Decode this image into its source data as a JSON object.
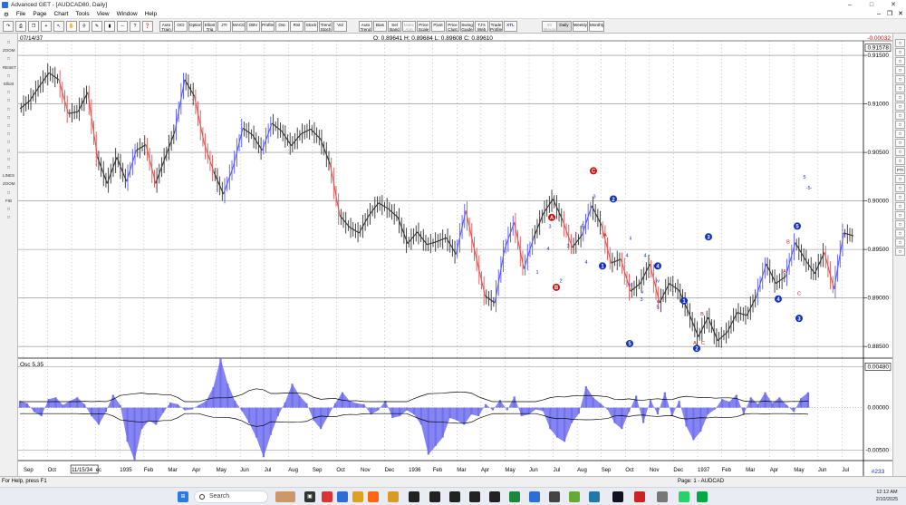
{
  "window": {
    "title": "Advanced GET - [AUDCAD80, Daily]"
  },
  "menu": [
    "File",
    "Page",
    "Chart",
    "Tools",
    "View",
    "Window",
    "Help"
  ],
  "toolbar": [
    {
      "label": "Auto Train",
      "state": "normal"
    },
    {
      "label": "OCI",
      "state": "normal"
    },
    {
      "label": "Option",
      "state": "normal"
    },
    {
      "label": "Elliott Trig",
      "state": "normal"
    },
    {
      "label": "JTI",
      "state": "normal"
    },
    {
      "label": "MACD",
      "state": "normal"
    },
    {
      "label": "OBV",
      "state": "normal"
    },
    {
      "label": "Profile",
      "state": "normal"
    },
    {
      "label": "Osc",
      "state": "normal"
    },
    {
      "label": "RSI",
      "state": "normal"
    },
    {
      "label": "Stock",
      "state": "normal"
    },
    {
      "label": "Trend Stoch",
      "state": "normal"
    },
    {
      "label": "Vol",
      "state": "normal"
    },
    {
      "label": "Auto Trend",
      "state": "normal"
    },
    {
      "label": "Bias",
      "state": "normal"
    },
    {
      "label": "Sel Band",
      "state": "normal"
    },
    {
      "label": "Make Ann",
      "state": "disabled"
    },
    {
      "label": "Price Scale",
      "state": "normal"
    },
    {
      "label": "Pivot",
      "state": "normal"
    },
    {
      "label": "Price Clust",
      "state": "normal"
    },
    {
      "label": "Swing Guide",
      "state": "normal"
    },
    {
      "label": "TJ's Web",
      "state": "normal"
    },
    {
      "label": "Trade Profile",
      "state": "normal"
    },
    {
      "label": "XTL",
      "state": "blue"
    },
    {
      "label": "60 Minute",
      "state": "disabled"
    },
    {
      "label": "Daily",
      "state": "active"
    },
    {
      "label": "Weekly",
      "state": "normal"
    },
    {
      "label": "Monthly",
      "state": "normal"
    }
  ],
  "left_tools": [
    "",
    "ZOOM",
    "",
    "RESET",
    "",
    "Elliott",
    "",
    "",
    "",
    "",
    "",
    "",
    "",
    "",
    "",
    "",
    "LINES",
    "ZOOM",
    "",
    "FIB",
    "",
    ""
  ],
  "right_tools": [
    "",
    "",
    "",
    "",
    "",
    "",
    "",
    "",
    "",
    "",
    "",
    "",
    "",
    "",
    "PTI",
    "",
    "",
    "",
    "",
    "",
    "",
    "",
    "",
    ""
  ],
  "chart_header": {
    "date": "07/14/37",
    "ohlc": "O: 0.89641   H: 0.89684   L: 0.89608   C: 0.89610",
    "last_change": "-0.00032"
  },
  "oscillator_label": "Osc 5,35",
  "bar_count": "#233",
  "status": {
    "left": "For Help, press F1",
    "right": "Page: 1 - AUDCAD"
  },
  "taskbar": {
    "search": "Search",
    "time": "12:12 AM",
    "date": "2/10/2025"
  },
  "colors": {
    "bull_wave": "#5a5aff",
    "bear_wave": "#e05555",
    "neutral": "#333333",
    "osc_fill": "#7070f0",
    "wave_label_blue": "#1030c0",
    "wave_label_red": "#d01010"
  },
  "chart_data": [
    {
      "type": "line",
      "title": "",
      "xlabel": "",
      "ylabel": "",
      "ylim": [
        0.8838,
        0.9165
      ],
      "y_ticks": [
        0.915,
        0.91,
        0.905,
        0.9,
        0.895,
        0.89,
        0.885
      ],
      "y_marker": 0.91578,
      "x_ticks": [
        "Sep",
        "Oct",
        "11/15/34",
        "ec",
        "1935",
        "Feb",
        "Mar",
        "Apr",
        "May",
        "Jun",
        "Jul",
        "Aug",
        "Sep",
        "Oct",
        "Nov",
        "Dec",
        "1936",
        "Feb",
        "Mar",
        "Apr",
        "May",
        "Jun",
        "Jul",
        "Aug",
        "Sep",
        "Oct",
        "Nov",
        "Dec",
        "1937",
        "Feb",
        "Mar",
        "Apr",
        "May",
        "Jun",
        "Jul"
      ],
      "series": [
        {
          "values": [
            0.9095,
            0.9103,
            0.9118,
            0.9132,
            0.9125,
            0.909,
            0.9092,
            0.9112,
            0.9045,
            0.9018,
            0.9045,
            0.902,
            0.9052,
            0.9058,
            0.9018,
            0.9045,
            0.9072,
            0.9125,
            0.9108,
            0.906,
            0.903,
            0.9007,
            0.9035,
            0.9075,
            0.9068,
            0.9052,
            0.908,
            0.9072,
            0.9057,
            0.9069,
            0.9074,
            0.9064,
            0.9038,
            0.8985,
            0.8973,
            0.8967,
            0.8985,
            0.8998,
            0.8992,
            0.8983,
            0.8956,
            0.8968,
            0.8955,
            0.8958,
            0.8962,
            0.8945,
            0.899,
            0.8945,
            0.8902,
            0.8895,
            0.895,
            0.8978,
            0.893,
            0.8962,
            0.8987,
            0.9002,
            0.898,
            0.8952,
            0.8965,
            0.8995,
            0.8975,
            0.8936,
            0.894,
            0.8907,
            0.8915,
            0.8935,
            0.8895,
            0.8915,
            0.8908,
            0.8885,
            0.886,
            0.888,
            0.8856,
            0.8865,
            0.8885,
            0.8882,
            0.8902,
            0.8935,
            0.8915,
            0.8922,
            0.8957,
            0.894,
            0.8925,
            0.8947,
            0.8909,
            0.8967,
            0.8964
          ]
        }
      ],
      "wave_labels": [
        {
          "text": "A",
          "style": "red-circle",
          "x": 0.898,
          "y": 0.8983
        },
        {
          "text": "B",
          "style": "red-circle",
          "x": 0.8911,
          "y": 0.8911
        },
        {
          "text": "C",
          "style": "red-circle",
          "x": 0.9031,
          "y": 0.9031
        },
        {
          "text": "1",
          "style": "blue-circle",
          "x": 0.8933,
          "y": 0.8933
        },
        {
          "text": "2",
          "style": "blue-circle",
          "x": 0.9002,
          "y": 0.9002
        },
        {
          "text": "3",
          "style": "blue-circle",
          "x": 0.8879,
          "y": 0.8879
        },
        {
          "text": "4",
          "style": "blue-circle",
          "x": 0.8933,
          "y": 0.8933
        },
        {
          "text": "5",
          "style": "blue-circle",
          "x": 0.8853,
          "y": 0.8853
        },
        {
          "text": "1",
          "style": "blue-circle",
          "x": 0.8897,
          "y": 0.8897
        },
        {
          "text": "2",
          "style": "blue-circle",
          "x": 0.8848,
          "y": 0.8848
        },
        {
          "text": "3",
          "style": "blue-circle",
          "x": 0.8963,
          "y": 0.8963
        },
        {
          "text": "4",
          "style": "blue-circle",
          "x": 0.8899,
          "y": 0.8899
        },
        {
          "text": "5",
          "style": "blue-circle",
          "x": 0.8974,
          "y": 0.8974
        },
        {
          "text": "5",
          "style": "blue-text",
          "x": 0.9023,
          "y": 0.9023
        },
        {
          "text": "3",
          "style": "blue-text",
          "x": 0.9003,
          "y": 0.9003
        },
        {
          "text": "4",
          "style": "blue-text",
          "x": 0.8949,
          "y": 0.8949
        },
        {
          "text": "3",
          "style": "blue-text",
          "x": 0.8972,
          "y": 0.8972
        },
        {
          "text": "5",
          "style": "blue-text",
          "x": 0.8972,
          "y": 0.8972
        },
        {
          "text": "4",
          "style": "blue-text",
          "x": 0.8935,
          "y": 0.8935
        },
        {
          "text": "2",
          "style": "blue-text",
          "x": 0.8916,
          "y": 0.8916
        },
        {
          "text": "1",
          "style": "blue-text",
          "x": 0.8925,
          "y": 0.8925
        },
        {
          "text": "3",
          "style": "blue-text",
          "x": 0.8952,
          "y": 0.8952
        },
        {
          "text": "A",
          "style": "red-text",
          "x": 0.8963,
          "y": 0.8963
        },
        {
          "text": "ii",
          "style": "blue-text",
          "x": 0.896,
          "y": 0.896
        },
        {
          "text": "4",
          "style": "blue-text",
          "x": 0.8942,
          "y": 0.8942
        },
        {
          "text": "4",
          "style": "blue-text",
          "x": 0.8942,
          "y": 0.8942
        },
        {
          "text": "iii",
          "style": "blue-text",
          "x": 0.8912,
          "y": 0.8912
        },
        {
          "text": "v",
          "style": "blue-text",
          "x": 0.8905,
          "y": 0.8905
        },
        {
          "text": "3",
          "style": "blue-text",
          "x": 0.8897,
          "y": 0.8897
        },
        {
          "text": "iv",
          "style": "blue-text",
          "x": 0.8916,
          "y": 0.8916
        },
        {
          "text": "v",
          "style": "blue-text",
          "x": 0.8895,
          "y": 0.8895
        },
        {
          "text": "5",
          "style": "blue-text",
          "x": 0.8889,
          "y": 0.8889
        },
        {
          "text": "B",
          "style": "red-text",
          "x": 0.8882,
          "y": 0.8882
        },
        {
          "text": "A",
          "style": "red-text",
          "x": 0.8852,
          "y": 0.8852
        },
        {
          "text": "C",
          "style": "red-text",
          "x": 0.8852,
          "y": 0.8852
        },
        {
          "text": "B",
          "style": "red-text",
          "x": 0.8956,
          "y": 0.8956
        },
        {
          "text": "A",
          "style": "red-text",
          "x": 0.8926,
          "y": 0.8926
        },
        {
          "text": "C",
          "style": "red-text",
          "x": 0.8903,
          "y": 0.8903
        },
        {
          "text": "-5-",
          "style": "blue-text",
          "x": 0.9012,
          "y": 0.9012
        }
      ]
    },
    {
      "type": "area",
      "title": "Osc 5,35",
      "ylim": [
        -0.0062,
        0.0058
      ],
      "y_ticks": [
        0.0048,
        0.0,
        -0.005
      ],
      "y_tick_labels": [
        "0.00480",
        "0.00000",
        "-0.00500"
      ],
      "values": [
        0.0008,
        0.0005,
        -0.0005,
        -0.001,
        0.001,
        0.0012,
        0.0003,
        0.0008,
        0.0012,
        0.0004,
        -0.001,
        -0.002,
        -0.0005,
        0.0015,
        0.0003,
        -0.004,
        -0.0062,
        -0.0025,
        -0.0015,
        -0.002,
        -0.0006,
        0.0006,
        0.0004,
        -0.0003,
        -0.0002,
        0.0003,
        0.0008,
        0.0024,
        0.0058,
        0.0028,
        0.0008,
        -0.0004,
        -0.0018,
        -0.0035,
        -0.0058,
        -0.0032,
        -0.001,
        0.0006,
        0.0028,
        0.0014,
        0.0005,
        -0.0015,
        -0.0025,
        -0.001,
        0.0005,
        0.0018,
        0.0008,
        0.0005,
        0.0004,
        -0.0008,
        -0.0003,
        0.0008,
        -0.0012,
        -0.001,
        -0.0003,
        -0.0008,
        -0.002,
        -0.0055,
        -0.0045,
        -0.0035,
        -0.0012,
        -0.0015,
        -0.002,
        -0.0008,
        -0.001,
        0.0004,
        -0.0003,
        0.0009,
        -0.0003,
        0.0013,
        -0.001,
        -0.0008,
        -0.0002,
        -0.0004,
        -0.0025,
        -0.0035,
        -0.004,
        -0.0018,
        -0.0007,
        0.0025,
        0.0012,
        0.0005,
        -0.0002,
        -0.0018,
        -0.0025,
        -0.0005,
        0.0014,
        -0.0018,
        0.0009,
        -0.0008,
        0.0018,
        -0.001,
        0.0008,
        -0.0022,
        -0.0038,
        -0.0028,
        -0.0008,
        -0.0002,
        0.001,
        0.0007,
        0.0015,
        -0.0008,
        0.0012,
        0.0004,
        0.0018,
        0.0005,
        0.0012,
        0.0003,
        -0.0005,
        0.0011,
        0.0018
      ]
    }
  ]
}
